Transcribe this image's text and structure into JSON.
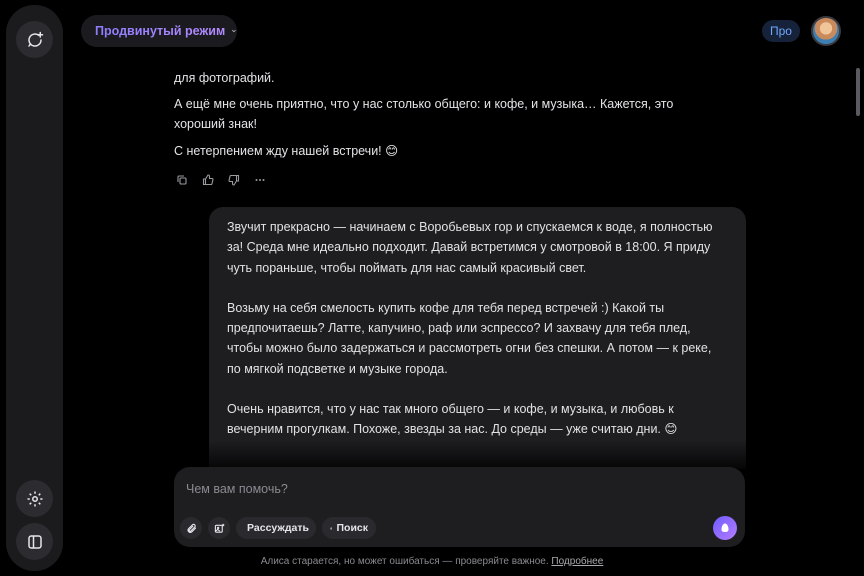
{
  "header": {
    "mode_label": "Продвинутый режим",
    "pro_label": "Про"
  },
  "assistant": {
    "lines": [
      "для фотографий.",
      "А ещё мне очень приятно, что у нас столько общего: и кофе, и музыка… Кажется, это хороший знак!",
      "С нетерпением жду нашей встречи! 😊"
    ]
  },
  "user_message": {
    "paragraphs": [
      "Звучит прекрасно — начинаем с Воробьевых гор и спускаемся к воде, я полностью за! Среда мне идеально подходит. Давай встретимся у смотровой в 18:00. Я приду чуть пораньше, чтобы поймать для нас самый красивый свет.",
      "Возьму на себя смелость купить кофе для тебя перед встречей :) Какой ты предпочитаешь? Латте, капучино, раф или эспрессо? И захвачу для тебя плед, чтобы можно было задержаться и рассмотреть огни без спешки. А потом — к реке, по мягкой подсветке и музыке города.",
      "Очень нравится, что у нас так много общего — и кофе, и музыка, и любовь к вечерним прогулкам. Похоже, звезды за нас. До среды — уже считаю дни. 😊"
    ]
  },
  "composer": {
    "placeholder": "Чем вам помочь?",
    "reason_label": "Рассуждать",
    "search_label": "Поиск"
  },
  "footer": {
    "disclaimer": "Алиса старается, но может ошибаться — проверяйте важное.",
    "link": "Подробнее"
  },
  "icons": {
    "sidebar_top": "new-chat-icon",
    "sidebar_settings": "gear-icon",
    "sidebar_toggle": "panel-icon",
    "actions": [
      "copy-icon",
      "like-icon",
      "dislike-icon",
      "more-icon"
    ],
    "composer": [
      "attach-icon",
      "image-icon",
      "sparkle-icon",
      "globe-icon",
      "send-icon"
    ]
  },
  "colors": {
    "background": "#000000",
    "surface": "#1e1e21",
    "accent": "#8e7cff",
    "pro": "#6fa8ff"
  }
}
